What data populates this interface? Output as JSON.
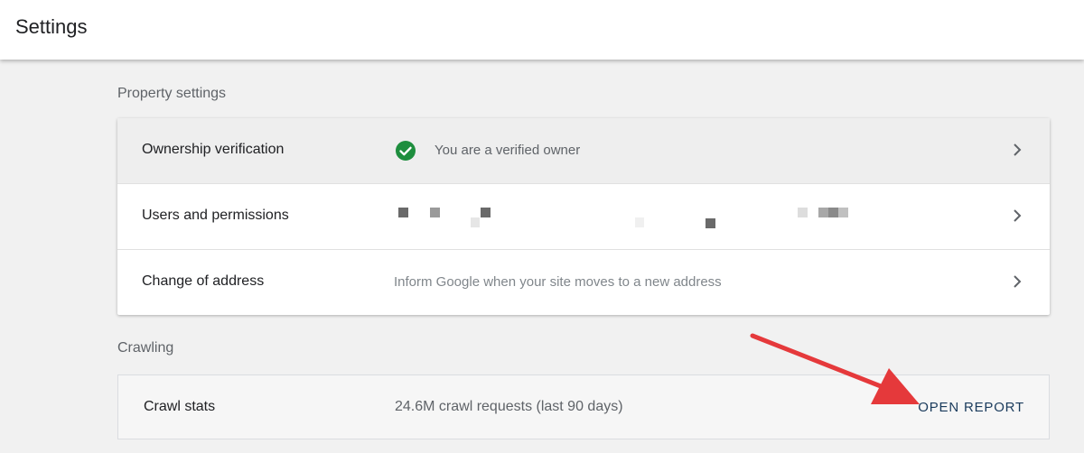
{
  "header": {
    "title": "Settings"
  },
  "property": {
    "section_label": "Property settings",
    "rows": [
      {
        "label": "Ownership verification",
        "value": "You are a verified owner"
      },
      {
        "label": "Users and permissions",
        "value": ""
      },
      {
        "label": "Change of address",
        "value": "Inform Google when your site moves to a new address"
      }
    ]
  },
  "crawling": {
    "section_label": "Crawling",
    "label": "Crawl stats",
    "value": "24.6M crawl requests (last 90 days)",
    "action": "OPEN REPORT"
  },
  "colors": {
    "verified_green": "#1e8e3e",
    "annotation_arrow": "#e5393b",
    "highlight_row": "#eeeeee"
  },
  "icons": [
    "check-circle-icon",
    "chevron-right-icon",
    "annotation-arrow-icon"
  ]
}
